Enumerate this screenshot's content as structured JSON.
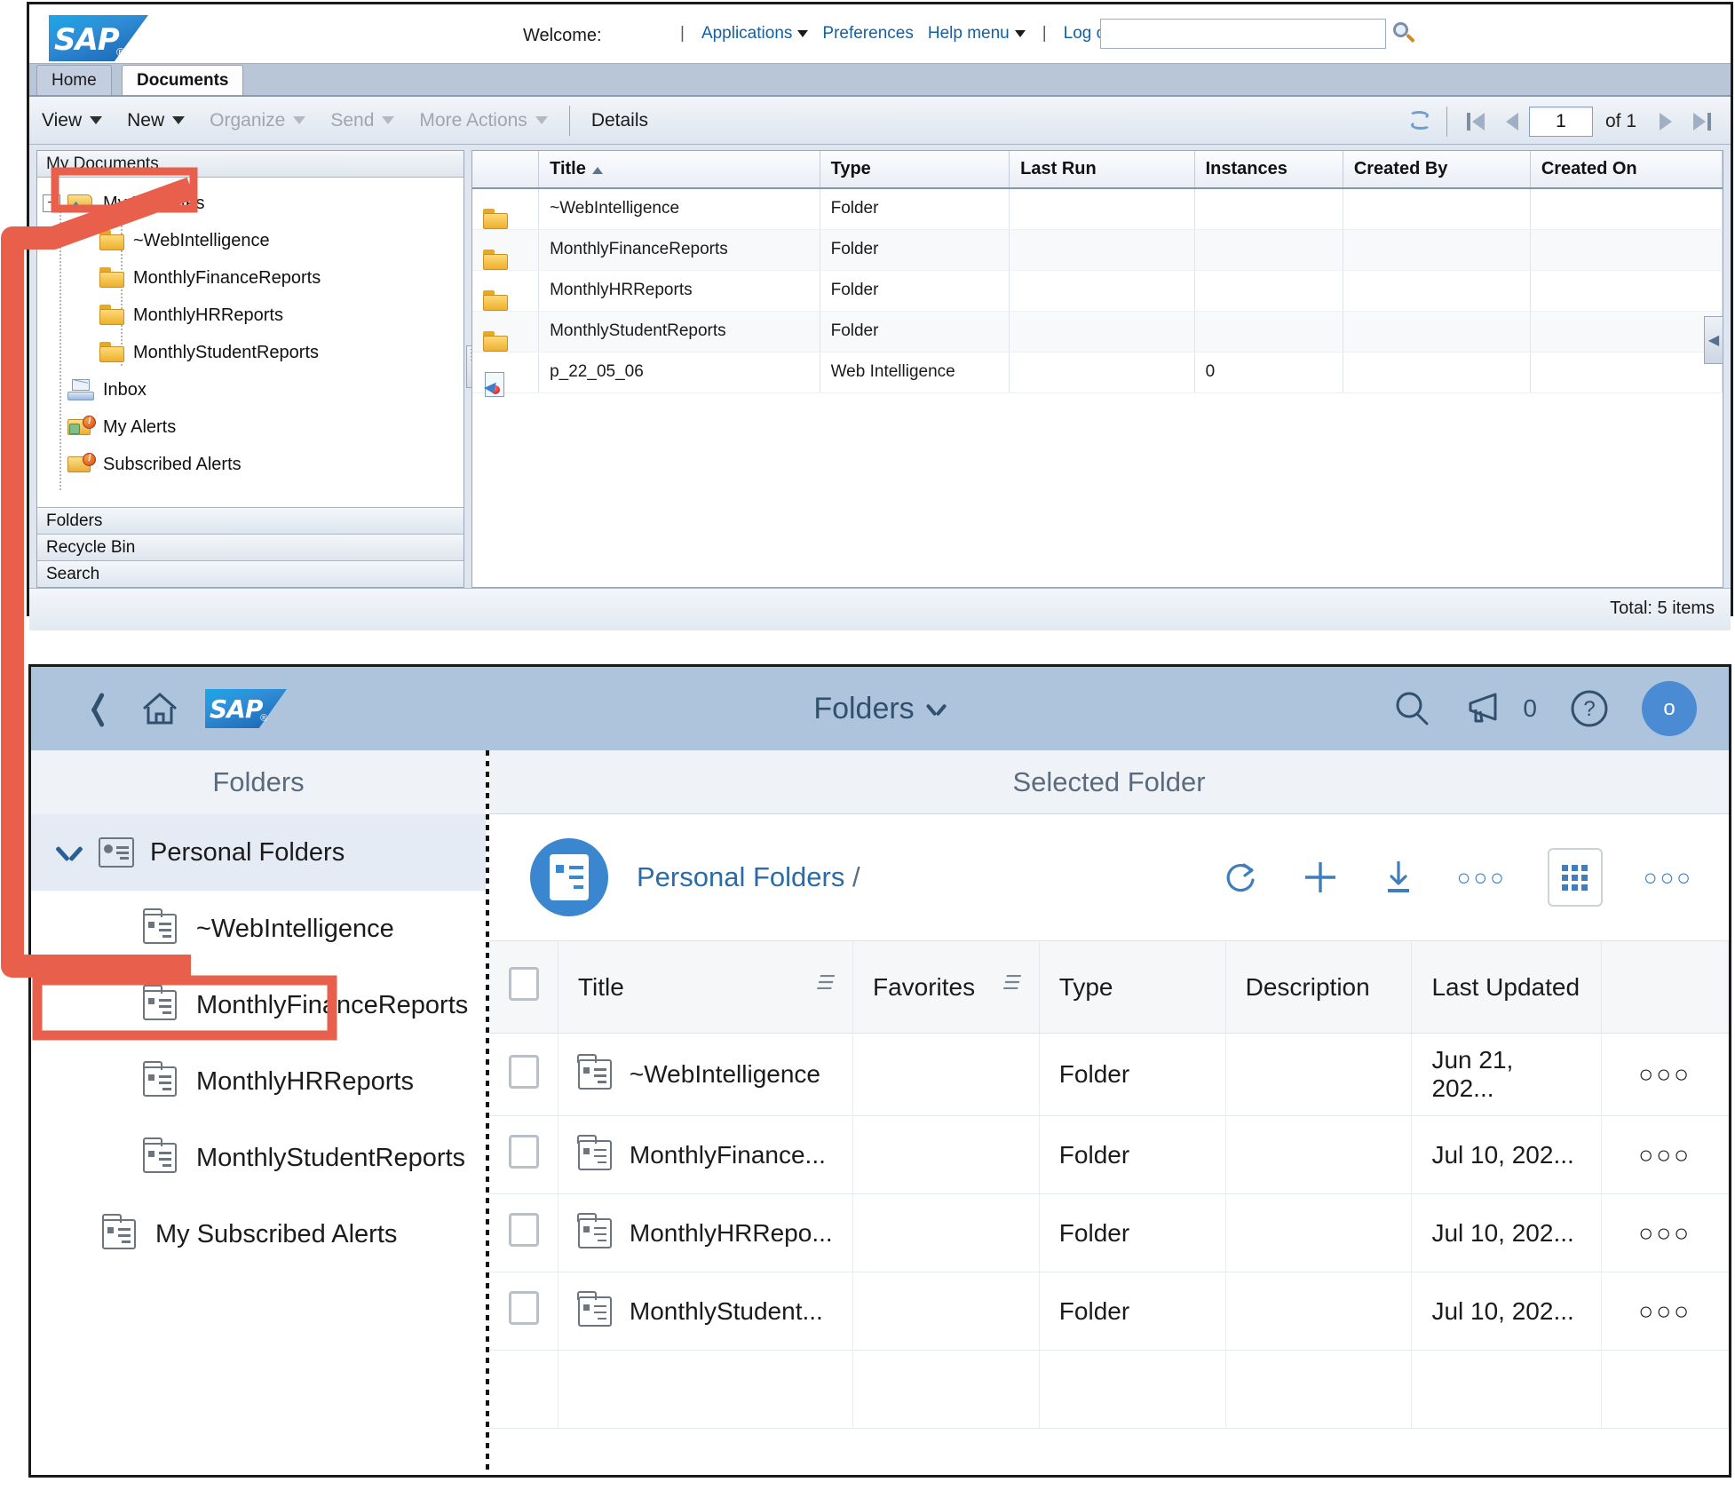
{
  "classic": {
    "brand": "SAP",
    "welcome_label": "Welcome:",
    "nav": {
      "applications": "Applications",
      "preferences": "Preferences",
      "help_menu": "Help menu",
      "log_off": "Log off",
      "search_value": "",
      "search_placeholder": ""
    },
    "tabs": [
      {
        "label": "Home",
        "active": false
      },
      {
        "label": "Documents",
        "active": true
      }
    ],
    "toolbar": {
      "view": "View",
      "new": "New",
      "organize": "Organize",
      "send": "Send",
      "more_actions": "More Actions",
      "details": "Details"
    },
    "pager": {
      "page_value": "1",
      "of_label": "of 1"
    },
    "tree": {
      "pane_title": "My Documents",
      "root": {
        "label": "My Favorites",
        "icon": "favorites-folder-icon",
        "expanded": true,
        "highlighted": true
      },
      "children": [
        {
          "label": "~WebIntelligence",
          "icon": "folder-icon"
        },
        {
          "label": "MonthlyFinanceReports",
          "icon": "folder-icon"
        },
        {
          "label": "MonthlyHRReports",
          "icon": "folder-icon"
        },
        {
          "label": "MonthlyStudentReports",
          "icon": "folder-icon"
        }
      ],
      "siblings": [
        {
          "label": "Inbox",
          "icon": "inbox-icon"
        },
        {
          "label": "My Alerts",
          "icon": "alert-person-icon"
        },
        {
          "label": "Subscribed Alerts",
          "icon": "alert-folder-icon"
        }
      ],
      "accordion": [
        {
          "label": "Folders"
        },
        {
          "label": "Recycle Bin"
        },
        {
          "label": "Search"
        }
      ]
    },
    "grid": {
      "columns": [
        "Title",
        "Type",
        "Last Run",
        "Instances",
        "Created By",
        "Created On"
      ],
      "sort_column": "Title",
      "sort_direction": "asc",
      "rows": [
        {
          "icon": "folder-icon",
          "title": "~WebIntelligence",
          "type": "Folder",
          "last_run": "",
          "instances": "",
          "created_by": "",
          "created_on": ""
        },
        {
          "icon": "folder-icon",
          "title": "MonthlyFinanceReports",
          "type": "Folder",
          "last_run": "",
          "instances": "",
          "created_by": "",
          "created_on": ""
        },
        {
          "icon": "folder-icon",
          "title": "MonthlyHRReports",
          "type": "Folder",
          "last_run": "",
          "instances": "",
          "created_by": "",
          "created_on": ""
        },
        {
          "icon": "folder-icon",
          "title": "MonthlyStudentReports",
          "type": "Folder",
          "last_run": "",
          "instances": "",
          "created_by": "",
          "created_on": ""
        },
        {
          "icon": "webi-document-icon",
          "title": "p_22_05_06",
          "type": "Web Intelligence",
          "last_run": "",
          "instances": "0",
          "created_by": "",
          "created_on": ""
        }
      ]
    },
    "status": {
      "total": "Total: 5 items"
    }
  },
  "fiori": {
    "brand": "SAP",
    "shell": {
      "back_icon": "chevron-left-icon",
      "home_icon": "home-icon",
      "title": "Folders",
      "search_icon": "search-icon",
      "notifications_icon": "megaphone-icon",
      "notifications_count": "0",
      "help_icon": "question-circle-icon",
      "avatar_initial": "o"
    },
    "left": {
      "title": "Folders",
      "root": {
        "label": "Personal Folders",
        "icon": "personal-folders-icon",
        "expanded": true,
        "highlighted": true
      },
      "children": [
        {
          "label": "~WebIntelligence",
          "icon": "folder-doc-icon"
        },
        {
          "label": "MonthlyFinanceReports",
          "icon": "folder-doc-icon"
        },
        {
          "label": "MonthlyHRReports",
          "icon": "folder-doc-icon"
        },
        {
          "label": "MonthlyStudentReports",
          "icon": "folder-doc-icon"
        }
      ],
      "extra": [
        {
          "label": "My Subscribed Alerts",
          "icon": "folder-doc-icon"
        }
      ]
    },
    "right": {
      "title": "Selected Folder",
      "breadcrumb": "Personal Folders",
      "breadcrumb_sep": "/",
      "actions": [
        {
          "name": "refresh-icon"
        },
        {
          "name": "add-icon"
        },
        {
          "name": "download-icon"
        },
        {
          "name": "more-dots-icon"
        },
        {
          "name": "grid-view-icon"
        },
        {
          "name": "overflow-dots-icon"
        }
      ],
      "table": {
        "columns": [
          "Title",
          "Favorites",
          "Type",
          "Description",
          "Last Updated"
        ],
        "rows": [
          {
            "icon": "folder-doc-icon",
            "title": "~WebIntelligence",
            "favorites": "",
            "type": "Folder",
            "description": "",
            "last_updated": "Jun 21, 202...",
            "actions": "○○○"
          },
          {
            "icon": "folder-doc-icon",
            "title": "MonthlyFinance...",
            "favorites": "",
            "type": "Folder",
            "description": "",
            "last_updated": "Jul 10, 202...",
            "actions": "○○○"
          },
          {
            "icon": "folder-doc-icon",
            "title": "MonthlyHRRepo...",
            "favorites": "",
            "type": "Folder",
            "description": "",
            "last_updated": "Jul 10, 202...",
            "actions": "○○○"
          },
          {
            "icon": "folder-doc-icon",
            "title": "MonthlyStudent...",
            "favorites": "",
            "type": "Folder",
            "description": "",
            "last_updated": "Jul 10, 202...",
            "actions": "○○○"
          }
        ]
      }
    }
  },
  "annotation": {
    "accent_color": "#E8604C",
    "callout_from": "My Favorites",
    "callout_to": "Personal Folders"
  }
}
